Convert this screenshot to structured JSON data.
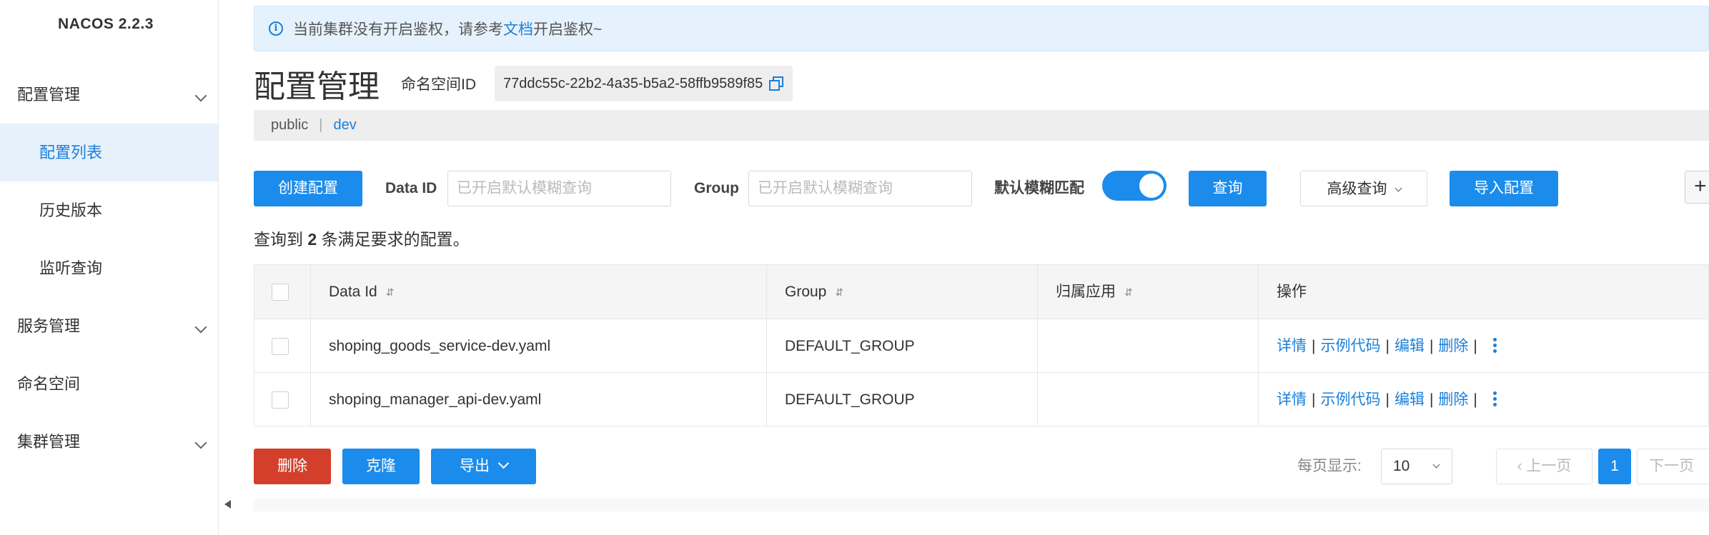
{
  "sidebar": {
    "brand": "NACOS 2.2.3",
    "items": [
      {
        "label": "配置管理",
        "expandable": true
      },
      {
        "label": "配置列表",
        "active": true
      },
      {
        "label": "历史版本"
      },
      {
        "label": "监听查询"
      },
      {
        "label": "服务管理",
        "expandable": true
      },
      {
        "label": "命名空间"
      },
      {
        "label": "集群管理",
        "expandable": true
      }
    ]
  },
  "notice": {
    "prefix": "当前集群没有开启鉴权，请参考",
    "link": "文档",
    "suffix": "开启鉴权~"
  },
  "header": {
    "title": "配置管理",
    "namespace_label": "命名空间ID",
    "namespace_id": "77ddc55c-22b2-4a35-b5a2-58ffb9589f85"
  },
  "namespaces": {
    "public": "public",
    "separator": "|",
    "dev": "dev"
  },
  "toolbar": {
    "create_label": "创建配置",
    "data_id_label": "Data ID",
    "data_id_placeholder": "已开启默认模糊查询",
    "group_label": "Group",
    "group_placeholder": "已开启默认模糊查询",
    "fuzzy_label": "默认模糊匹配",
    "fuzzy_enabled": true,
    "query_label": "查询",
    "advanced_label": "高级查询",
    "import_label": "导入配置",
    "side_plus": "+"
  },
  "result": {
    "prefix": "查询到",
    "count": "2",
    "suffix": "条满足要求的配置。"
  },
  "table": {
    "columns": [
      "Data Id",
      "Group",
      "归属应用",
      "操作"
    ],
    "sort_symbol": "⇵",
    "rows": [
      {
        "data_id": "shoping_goods_service-dev.yaml",
        "group": "DEFAULT_GROUP",
        "app": ""
      },
      {
        "data_id": "shoping_manager_api-dev.yaml",
        "group": "DEFAULT_GROUP",
        "app": ""
      }
    ],
    "actions": [
      "详情",
      "示例代码",
      "编辑",
      "删除"
    ],
    "action_sep": "|"
  },
  "footer": {
    "delete_label": "删除",
    "clone_label": "克隆",
    "export_label": "导出",
    "per_page_label": "每页显示:",
    "page_size": "10",
    "prev_label": "上一页",
    "current_page": "1",
    "next_label": "下一页"
  },
  "colors": {
    "primary": "#1b8cec",
    "link": "#1b7fd8",
    "danger": "#d33f2a",
    "notice_bg": "#e5f2fd",
    "active_bg": "#e6f1fb"
  }
}
